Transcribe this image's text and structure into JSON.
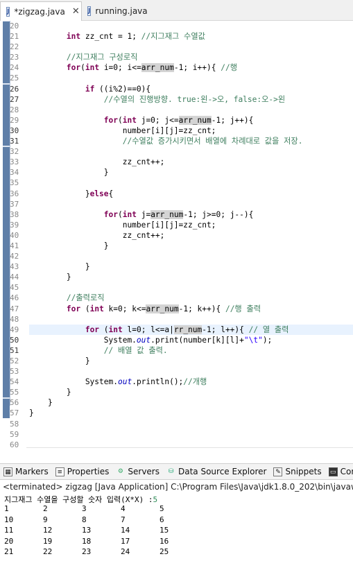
{
  "tabs": [
    {
      "label": "*zigzag.java",
      "active": true,
      "closable": true
    },
    {
      "label": "running.java",
      "active": false
    }
  ],
  "code_lines": [
    {
      "n": "20",
      "t": ""
    },
    {
      "n": "21",
      "t": "        <span class=\"kw\">int</span> zz_cnt = 1; <span class=\"cm\">//지그재그 수열값</span>"
    },
    {
      "n": "22",
      "t": ""
    },
    {
      "n": "23",
      "t": "        <span class=\"cm\">//지그재그 구성로직</span>"
    },
    {
      "n": "24",
      "t": "        <span class=\"kw\">for</span>(<span class=\"kw\">int</span> i=0; i&lt;=<span class=\"occ\">arr_num</span>-1; i++){ <span class=\"cm\">//행</span>"
    },
    {
      "n": "25",
      "t": ""
    },
    {
      "n": "26",
      "t": "            <span class=\"kw\">if</span> ((i%2)==0){"
    },
    {
      "n": "27",
      "t": "                <span class=\"cm\">//수열의 진행방향. true:왼-&gt;오, false:오-&gt;왼</span>"
    },
    {
      "n": "28",
      "t": ""
    },
    {
      "n": "29",
      "t": "                <span class=\"kw\">for</span>(<span class=\"kw\">int</span> j=0; j&lt;=<span class=\"occ\">arr_num</span>-1; j++){"
    },
    {
      "n": "30",
      "t": "                    number[i][j]=zz_cnt;"
    },
    {
      "n": "31",
      "t": "                    <span class=\"cm\">//수열값 증가시키면서 배열에 차례대로 값을 저장.</span>"
    },
    {
      "n": "32",
      "t": ""
    },
    {
      "n": "33",
      "t": "                    zz_cnt++;"
    },
    {
      "n": "34",
      "t": "                }"
    },
    {
      "n": "35",
      "t": ""
    },
    {
      "n": "36",
      "t": "            }<span class=\"kw\">else</span>{"
    },
    {
      "n": "37",
      "t": ""
    },
    {
      "n": "38",
      "t": "                <span class=\"kw\">for</span>(<span class=\"kw\">int</span> j=<span class=\"occ\">arr_num</span>-1; j&gt;=0; j--){"
    },
    {
      "n": "39",
      "t": "                    number[i][j]=zz_cnt;"
    },
    {
      "n": "40",
      "t": "                    zz_cnt++;"
    },
    {
      "n": "41",
      "t": "                }"
    },
    {
      "n": "42",
      "t": ""
    },
    {
      "n": "43",
      "t": "            }"
    },
    {
      "n": "44",
      "t": "        }"
    },
    {
      "n": "45",
      "t": ""
    },
    {
      "n": "46",
      "t": "        <span class=\"cm\">//출력로직</span>"
    },
    {
      "n": "47",
      "t": "        <span class=\"kw\">for</span> (<span class=\"kw\">int</span> k=0; k&lt;=<span class=\"occ\">arr_num</span>-1; k++){ <span class=\"cm\">//행 출력</span>"
    },
    {
      "n": "48",
      "t": ""
    },
    {
      "n": "49",
      "t": "            <span class=\"kw\">for</span> (<span class=\"kw\">int</span> l=0; l&lt;=a|<span class=\"occ\">rr_num</span>-1; l++){ <span class=\"cm\">// 열 출력</span>"
    },
    {
      "n": "50",
      "t": "                System.<span class=\"st\">out</span>.print(number[k][l]+<span class=\"str\">\"\\t\"</span>);"
    },
    {
      "n": "51",
      "t": "                <span class=\"cm\">// 배열 값 출력.</span>"
    },
    {
      "n": "52",
      "t": "            }"
    },
    {
      "n": "53",
      "t": ""
    },
    {
      "n": "54",
      "t": "            System.<span class=\"st\">out</span>.println();<span class=\"cm\">//개행</span>"
    },
    {
      "n": "55",
      "t": "        }"
    },
    {
      "n": "56",
      "t": "    }"
    },
    {
      "n": "57",
      "t": "}"
    },
    {
      "n": "58",
      "t": ""
    },
    {
      "n": "59",
      "t": ""
    },
    {
      "n": "60",
      "t": ""
    }
  ],
  "current_line": "49",
  "views": [
    "Markers",
    "Properties",
    "Servers",
    "Data Source Explorer",
    "Snippets",
    "Console"
  ],
  "console_status": "<terminated> zigzag [Java Application] C:\\Program Files\\Java\\jdk1.8.0_202\\bin\\javaw.exe",
  "console_prompt": "지그재그 수열을 구성할 숫자 입력(X*X) :",
  "console_input": "5",
  "console_rows": [
    [
      "1",
      "2",
      "3",
      "4",
      "5"
    ],
    [
      "10",
      "9",
      "8",
      "7",
      "6"
    ],
    [
      "11",
      "12",
      "13",
      "14",
      "15"
    ],
    [
      "20",
      "19",
      "18",
      "17",
      "16"
    ],
    [
      "21",
      "22",
      "23",
      "24",
      "25"
    ]
  ]
}
